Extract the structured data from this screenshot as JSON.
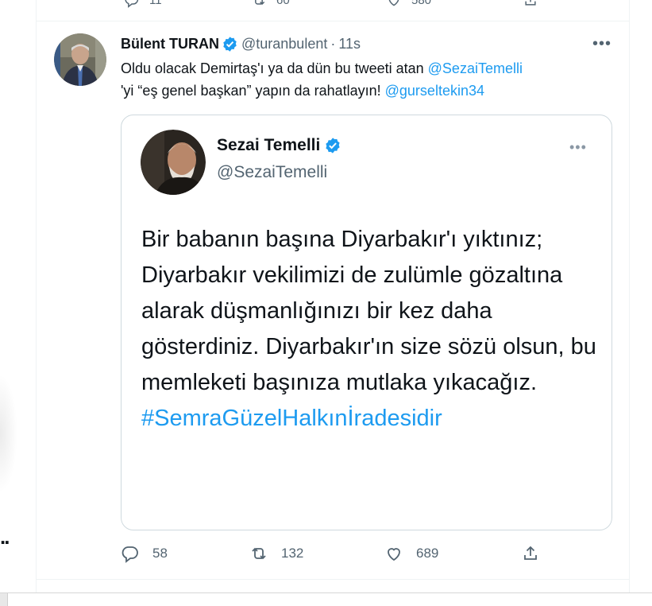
{
  "previous_tweet": {
    "replies": "11",
    "retweets": "60",
    "likes": "580"
  },
  "tweet": {
    "author_name": "Bülent TURAN",
    "author_handle": "@turanbulent",
    "separator": "·",
    "time": "11s",
    "more": "•••",
    "text_part1": "Oldu olacak Demirtaş'ı ya da dün bu tweeti atan ",
    "mention1": "@SezaiTemelli",
    "text_part2": "'yi “eş genel başkan” yapın da rahatlayın! ",
    "mention2": "@gurseltekin34",
    "quote": {
      "author_name": "Sezai Temelli",
      "author_handle": "@SezaiTemelli",
      "more": "•••",
      "body": "Bir babanın başına Diyarbakır'ı yıktınız; Diyarbakır vekilimizi de zulümle gözaltına alarak düşmanlığınızı bir kez daha gösterdiniz. Diyarbakır'ın size sözü olsun, bu memleketi başınıza mutlaka yıkacağız.",
      "hashtag": "#SemraGüzelHalkınİradesidir"
    },
    "replies": "58",
    "retweets": "132",
    "likes": "689"
  },
  "left_panel_text": "..",
  "colors": {
    "accent": "#1d9bf0",
    "text": "#0f1419",
    "secondary": "#536471",
    "border": "#cfd9de"
  },
  "icons": [
    "reply-icon",
    "retweet-icon",
    "like-icon",
    "share-icon",
    "verified-badge-icon",
    "more-icon"
  ]
}
